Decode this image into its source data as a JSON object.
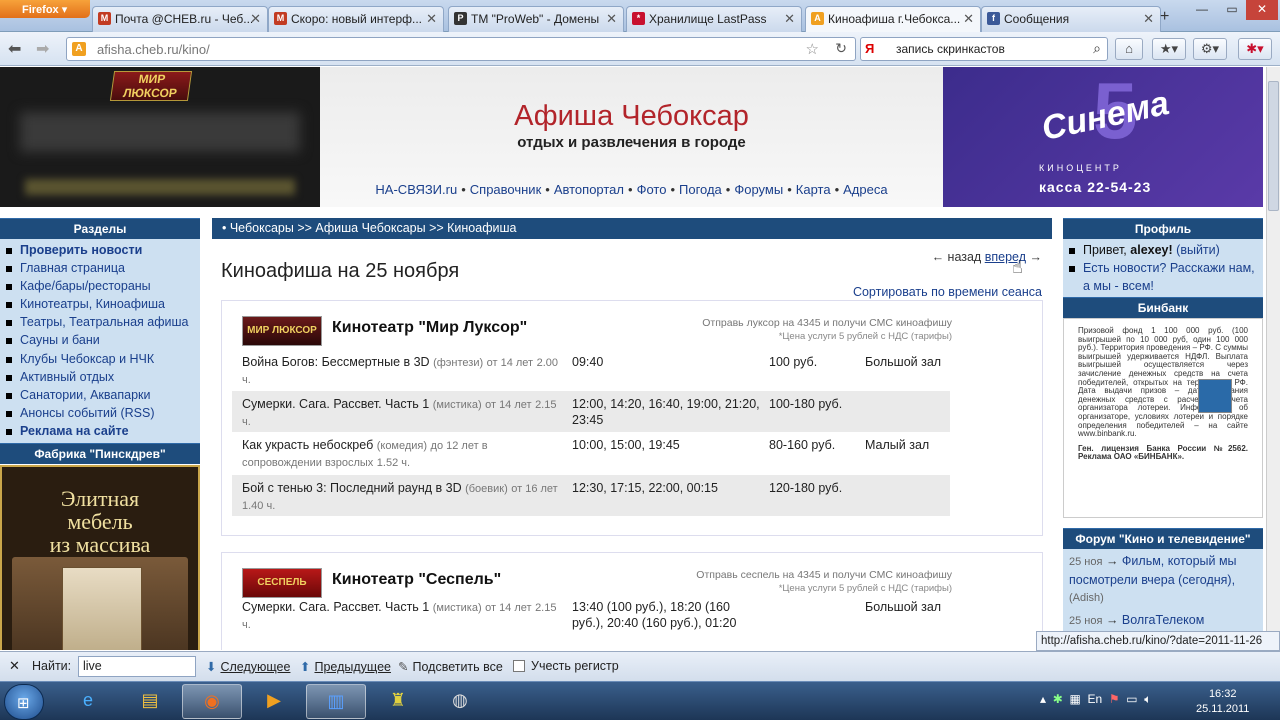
{
  "browser": {
    "app_button": "Firefox",
    "tabs": [
      {
        "label": "Почта @CHEB.ru - Чеб...",
        "icon": "gmail-icon",
        "color": "#c23b22",
        "glyph": "M"
      },
      {
        "label": "Скоро: новый интерф...",
        "icon": "gmail-icon",
        "color": "#c23b22",
        "glyph": "M"
      },
      {
        "label": "TM \"ProWeb\" - Домены",
        "icon": "proweb-icon",
        "color": "#333333",
        "glyph": "P"
      },
      {
        "label": "Хранилище LastPass",
        "icon": "lastpass-icon",
        "color": "#c8102e",
        "glyph": "*"
      },
      {
        "label": "Киноафиша г.Чебокса...",
        "icon": "afisha-icon",
        "color": "#f0a020",
        "glyph": "A"
      },
      {
        "label": "Сообщения",
        "icon": "facebook-icon",
        "color": "#3b5998",
        "glyph": "f"
      }
    ],
    "url": "afisha.cheb.ru/kino/",
    "search_value": "запись скринкастов",
    "status_url": "http://afisha.cheb.ru/kino/?date=2011-11-26"
  },
  "header": {
    "left_banner_logo": "МИР ЛЮКСОР",
    "title": "Афиша Чебоксар",
    "subtitle": "отдых и развлечения в городе",
    "nav": [
      "НА-СВЯЗИ.ru",
      "Справочник",
      "Автопортал",
      "Фото",
      "Погода",
      "Форумы",
      "Карта",
      "Адреса"
    ],
    "right_banner": {
      "number": "5",
      "name": "Синема",
      "sub": "КИНОЦЕНТР",
      "phone": "касса 22-54-23"
    }
  },
  "left": {
    "sections_title": "Разделы",
    "menu": [
      {
        "label": "Проверить новости",
        "bold": true
      },
      {
        "label": "Главная страница"
      },
      {
        "label": "Кафе/бары/рестораны"
      },
      {
        "label": "Кинотеатры, Киноафиша"
      },
      {
        "label": "Театры, Театральная афиша"
      },
      {
        "label": "Сауны и бани"
      },
      {
        "label": "Клубы Чебоксар и НЧК"
      },
      {
        "label": "Активный отдых"
      },
      {
        "label": "Санатории, Аквапарки"
      },
      {
        "label": "Анонсы событий (RSS)"
      },
      {
        "label": "Реклама на сайте",
        "bold": true
      }
    ],
    "ad_title": "Фабрика \"Пинскдрев\"",
    "ad_text_1": "Элитная",
    "ad_text_2": "мебель",
    "ad_text_3": "из массива"
  },
  "main": {
    "breadcrumb": "• Чебоксары >> Афиша Чебоксары >> Киноафиша",
    "page_title": "Киноафиша на 25 ноября",
    "back": "← назад",
    "forward": "вперед",
    "forward_arrow": "→",
    "sort": "Сортировать по времени сеанса",
    "cinemas": [
      {
        "name": "Кинотеатр \"Мир Луксор\"",
        "logo": "МИР ЛЮКСОР",
        "sms": "Отправь луксор на 4345 и получи СМС киноафишу",
        "sms_note": "*Цена услуги 5 рублей с НДС (тарифы)",
        "films": [
          {
            "title": "Война Богов: Бессмертные в 3D",
            "genre": "(фэнтези)",
            "age": "от 14 лет",
            "dur": "2.00 ч.",
            "times": "09:40",
            "price": "100 руб.",
            "hall": "Большой зал"
          },
          {
            "title": "Сумерки. Сага. Рассвет. Часть 1",
            "genre": "(мистика)",
            "age": "от 14 лет",
            "dur": "2.15 ч.",
            "times": "12:00, 14:20, 16:40, 19:00, 21:20, 23:45",
            "price": "100-180 руб.",
            "hall": ""
          },
          {
            "title": "Как украсть небоскреб",
            "genre": "(комедия)",
            "age": "до 12 лет в сопровождении взрослых",
            "dur": "1.52 ч.",
            "times": "10:00, 15:00, 19:45",
            "price": "80-160 руб.",
            "hall": "Малый зал"
          },
          {
            "title": "Бой с тенью 3: Последний раунд в 3D",
            "genre": "(боевик)",
            "age": "от 16 лет",
            "dur": "1.40 ч.",
            "times": "12:30, 17:15, 22:00, 00:15",
            "price": "120-180 руб.",
            "hall": ""
          }
        ]
      },
      {
        "name": "Кинотеатр \"Сеспель\"",
        "logo": "СЕСПЕЛЬ",
        "sms": "Отправь сеспель на 4345 и получи СМС киноафишу",
        "sms_note": "*Цена услуги 5 рублей с НДС (тарифы)",
        "films": [
          {
            "title": "Сумерки. Сага. Рассвет. Часть 1",
            "genre": "(мистика)",
            "age": "от 14 лет",
            "dur": "2.15 ч.",
            "times": "13:40 (100 руб.), 18:20 (160 руб.), 20:40 (160 руб.), 01:20",
            "price": "",
            "hall": "Большой зал"
          }
        ]
      }
    ]
  },
  "right": {
    "profile_title": "Профиль",
    "greeting": "Привет,",
    "user": "alexey!",
    "logout": "(выйти)",
    "news_prompt": "Есть новости? Расскажи нам, а мы - всем!",
    "bank_title": "Бинбанк",
    "bank_text": "Призовой фонд 1 100 000 руб. (100 выигрышей по 10 000 руб, один 100 000 руб.). Территория проведения – РФ. С суммы выигрышей удерживается НДФЛ. Выплата выигрышей осуществляется через зачисление денежных средств на счета победителей, открытых на территории РФ. Дата выдачи призов – дата списания денежных средств с расчетного счета организатора лотереи. Информация об организаторе, условиях лотереи и порядке определения победителей – на сайте www.binbank.ru.",
    "bank_license": "Ген. лицензия Банка России №2562. Реклама ОАО «БИНБАНК».",
    "forum_title": "Форум \"Кино и телевидение\"",
    "forum_posts": [
      {
        "date": "25 ноя",
        "title": "Фильм, который мы посмотрели вчера (сегодня),",
        "author": "(Adish)"
      },
      {
        "date": "25 ноя",
        "title": "ВолгаТелеком начинает вещание в сети"
      }
    ]
  },
  "findbar": {
    "label": "Найти:",
    "value": "live",
    "next": "Следующее",
    "prev": "Предыдущее",
    "highlight": "Подсветить все",
    "case": "Учесть регистр"
  },
  "taskbar": {
    "lang": "En",
    "time": "16:32",
    "date": "25.11.2011"
  }
}
